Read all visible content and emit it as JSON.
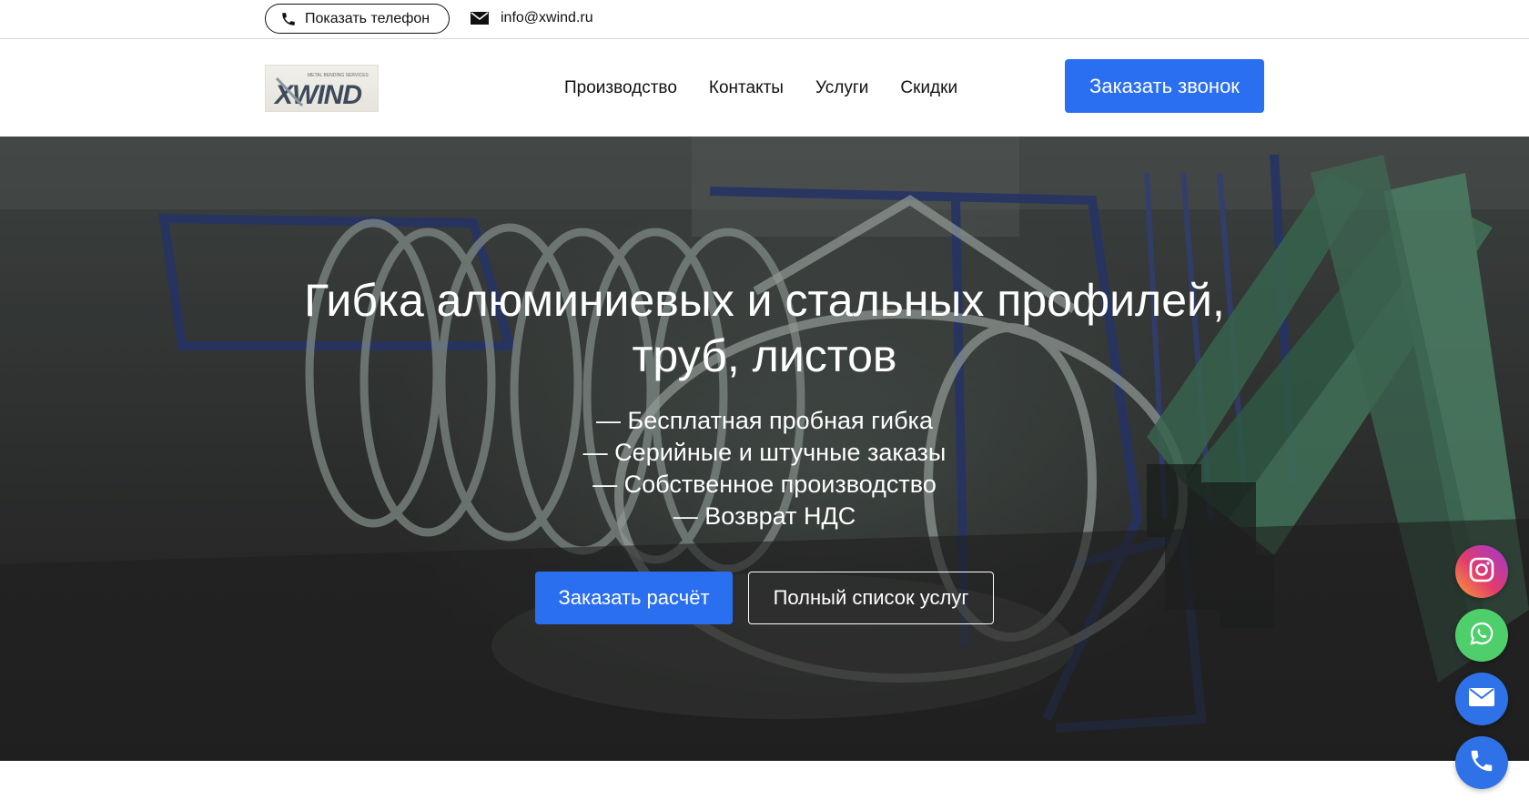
{
  "topbar": {
    "phone_button_label": "Показать телефон",
    "email": "info@xwind.ru"
  },
  "header": {
    "logo_text": "XWIND",
    "logo_tagline": "METAL BENDING SERVICES",
    "nav": [
      {
        "label": "Производство"
      },
      {
        "label": "Контакты"
      },
      {
        "label": "Услуги"
      },
      {
        "label": "Скидки"
      }
    ],
    "call_button_label": "Заказать звонок"
  },
  "hero": {
    "title_line1": "Гибка алюминиевых и стальных профилей,",
    "title_line2": "труб, листов",
    "bullets": [
      "— Бесплатная пробная гибка",
      "— Серийные и штучные заказы",
      "— Собственное производство",
      "— Возврат НДС"
    ],
    "primary_button_label": "Заказать расчёт",
    "secondary_button_label": "Полный список услуг"
  },
  "floating": {
    "icons": [
      "instagram-icon",
      "whatsapp-icon",
      "email-icon",
      "phone-icon"
    ]
  },
  "colors": {
    "accent": "#2a6ff0",
    "whatsapp": "#4fcf6b"
  }
}
